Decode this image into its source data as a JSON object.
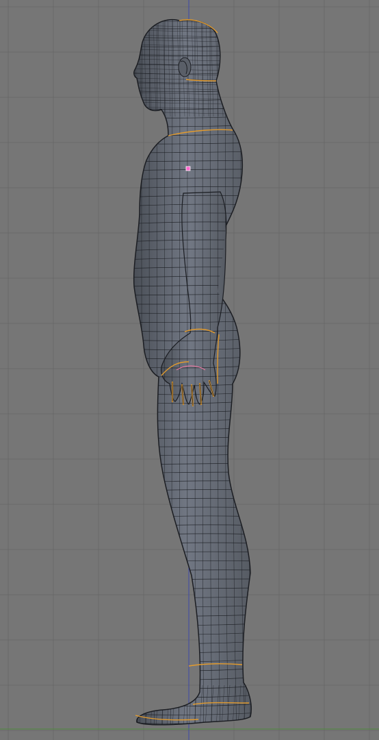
{
  "viewport": {
    "view": "side-orthographic",
    "background_color": "#767676",
    "grid_color": "#696969",
    "axis_colors": {
      "vertical": "#3f48a8",
      "horizontal": "#4f8a3c"
    },
    "show_grid": true
  },
  "model": {
    "name": "human-body-mesh",
    "display_mode": "solid-wireframe",
    "surface_color": "#6b7280",
    "wire_color": "#1b1d22",
    "seam_color": "#e39b2d",
    "selected_vertex_color": "#ff66cc"
  }
}
